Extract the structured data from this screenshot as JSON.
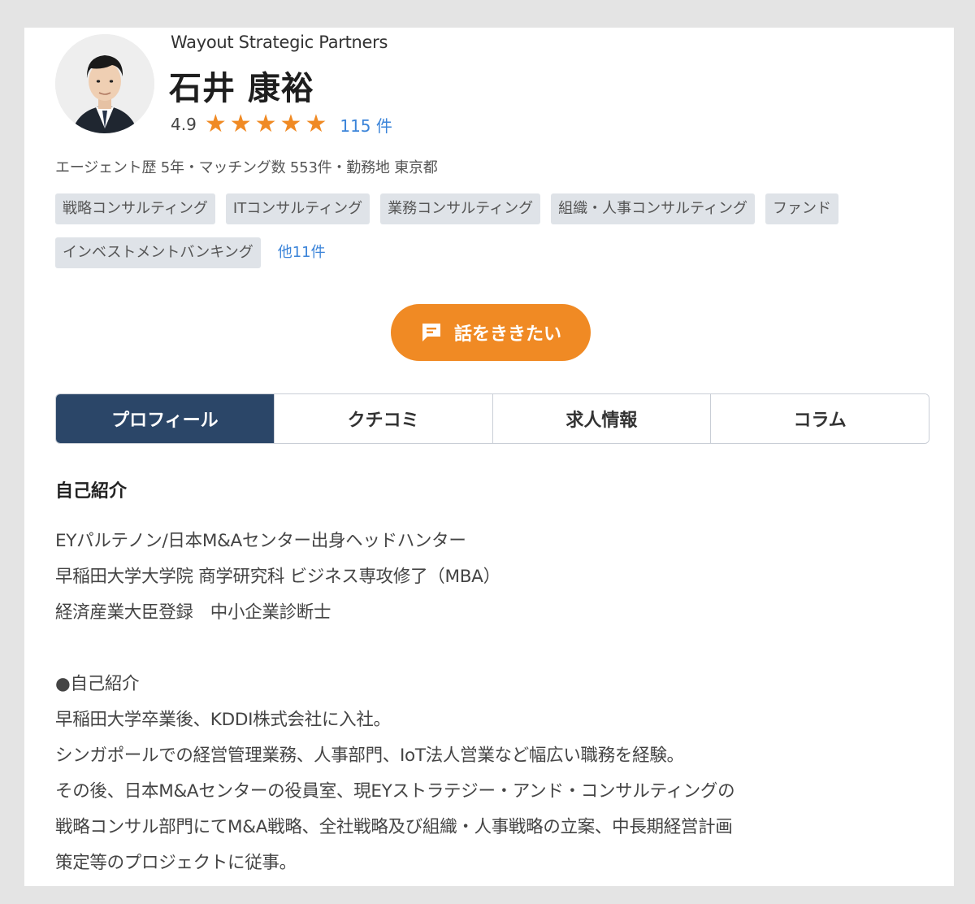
{
  "profile": {
    "company": "Wayout Strategic Partners",
    "name": "石井 康裕",
    "rating": "4.9",
    "stars": 5,
    "review_count": "115 件",
    "meta": "エージェント歴 5年・マッチング数 553件・勤務地 東京都"
  },
  "tags": [
    "戦略コンサルティング",
    "ITコンサルティング",
    "業務コンサルティング",
    "組織・人事コンサルティング",
    "ファンド",
    "インベストメントバンキング"
  ],
  "more_tags": "他11件",
  "cta": {
    "label": "話をききたい"
  },
  "tabs": [
    "プロフィール",
    "クチコミ",
    "求人情報",
    "コラム"
  ],
  "section": {
    "title": "自己紹介"
  },
  "intro_lines": [
    "EYパルテノン/日本M&Aセンター出身ヘッドハンター",
    "早稲田大学大学院 商学研究科 ビジネス専攻修了（MBA）",
    "経済産業大臣登録　中小企業診断士"
  ],
  "detail_heading": "●自己紹介",
  "detail_lines": [
    "早稲田大学卒業後、KDDI株式会社に入社。",
    "シンガポールでの経営管理業務、人事部門、IoT法人営業など幅広い職務を経験。",
    "その後、日本M&Aセンターの役員室、現EYストラテジー・アンド・コンサルティングの",
    "戦略コンサル部門にてM&A戦略、全社戦略及び組織・人事戦略の立案、中長期経営計画",
    "策定等のプロジェクトに従事。"
  ],
  "colors": {
    "accent_orange": "#f08a24",
    "tab_active": "#2b4668",
    "link_blue": "#3b84d9",
    "tag_bg": "#dfe3e8"
  }
}
